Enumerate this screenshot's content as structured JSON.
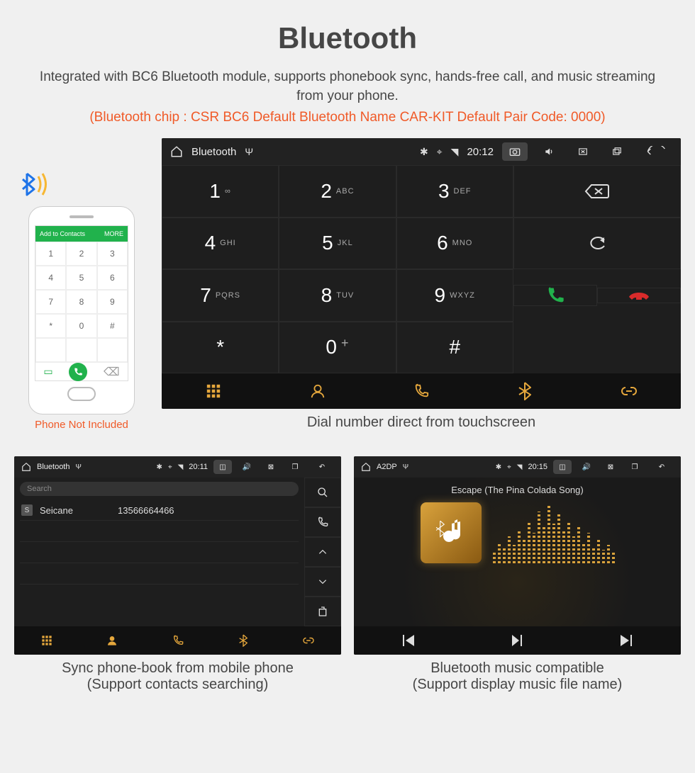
{
  "hero": {
    "title": "Bluetooth",
    "desc": "Integrated with BC6 Bluetooth module, supports phonebook sync, hands-free call, and music streaming from your phone.",
    "spec": "(Bluetooth chip : CSR BC6     Default Bluetooth Name CAR-KIT     Default Pair Code: 0000)"
  },
  "phone_mock": {
    "topbar": "Add to Contacts",
    "keys": [
      "1",
      "2",
      "3",
      "4",
      "5",
      "6",
      "7",
      "8",
      "9",
      "*",
      "0",
      "#"
    ],
    "caption": "Phone Not Included"
  },
  "dialer": {
    "status": {
      "title": "Bluetooth",
      "time": "20:12"
    },
    "keys": [
      {
        "d": "1",
        "l": "∞"
      },
      {
        "d": "2",
        "l": "ABC"
      },
      {
        "d": "3",
        "l": "DEF"
      },
      {
        "d": "4",
        "l": "GHI"
      },
      {
        "d": "5",
        "l": "JKL"
      },
      {
        "d": "6",
        "l": "MNO"
      },
      {
        "d": "7",
        "l": "PQRS"
      },
      {
        "d": "8",
        "l": "TUV"
      },
      {
        "d": "9",
        "l": "WXYZ"
      },
      {
        "d": "*",
        "l": ""
      },
      {
        "d": "0",
        "l": "+"
      },
      {
        "d": "#",
        "l": ""
      }
    ],
    "caption": "Dial number direct from touchscreen"
  },
  "contacts": {
    "status": {
      "title": "Bluetooth",
      "time": "20:11"
    },
    "search_placeholder": "Search",
    "rows": [
      {
        "badge": "S",
        "name": "Seicane",
        "number": "13566664466"
      }
    ],
    "caption1": "Sync phone-book from mobile phone",
    "caption2": "(Support contacts searching)"
  },
  "music": {
    "status": {
      "title": "A2DP",
      "time": "20:15"
    },
    "song": "Escape (The Pina Colada Song)",
    "caption1": "Bluetooth music compatible",
    "caption2": "(Support display music file name)"
  }
}
